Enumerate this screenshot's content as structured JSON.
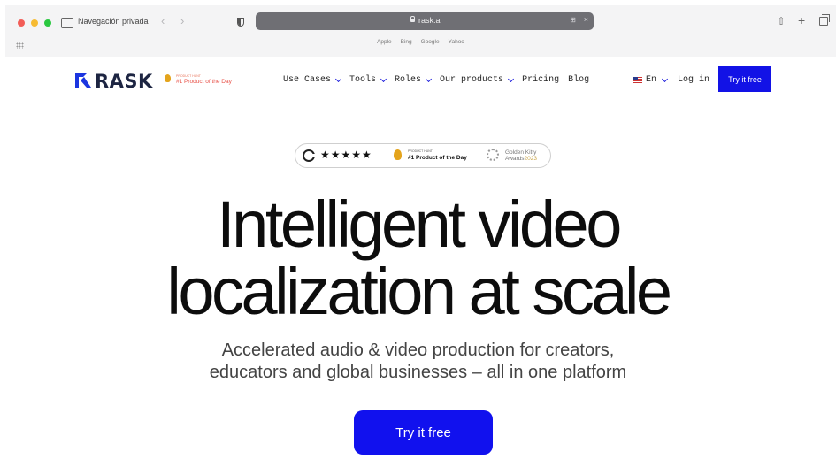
{
  "browser": {
    "private_label": "Navegación privada",
    "url": "rask.ai",
    "favorites": [
      "Apple",
      "Bing",
      "Google",
      "Yahoo"
    ]
  },
  "header": {
    "logo_text": "RASK",
    "ph_badge": {
      "overline": "PRODUCT HUNT",
      "title": "#1 Product of the Day"
    },
    "nav": [
      {
        "label": "Use Cases",
        "dropdown": true
      },
      {
        "label": "Tools",
        "dropdown": true
      },
      {
        "label": "Roles",
        "dropdown": true
      },
      {
        "label": "Our products",
        "dropdown": true
      },
      {
        "label": "Pricing",
        "dropdown": false
      },
      {
        "label": "Blog",
        "dropdown": false
      }
    ],
    "language": "En",
    "login": "Log in",
    "cta": "Try it free",
    "accent_color": "#1212e6"
  },
  "awards": {
    "stars": "★★★★★",
    "ph_overline": "PRODUCT HUNT",
    "ph_title": "#1 Product of the Day",
    "kitty_line1": "Golden Kitty",
    "kitty_line2": "Awards",
    "kitty_year": "2023"
  },
  "hero": {
    "title_line1": "Intelligent video",
    "title_line2": "localization at scale",
    "subtitle_line1": "Accelerated audio & video production for creators,",
    "subtitle_line2": "educators and global businesses – all in one platform",
    "cta": "Try it free"
  }
}
